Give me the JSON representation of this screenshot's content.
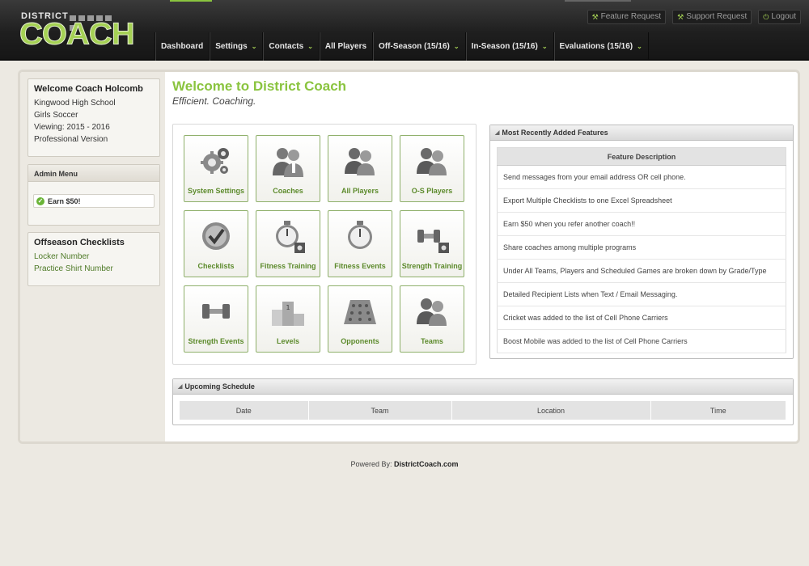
{
  "brand": {
    "top": "DISTRICT",
    "main": "COACH"
  },
  "toplinks": [
    {
      "icon": "wrench-icon",
      "label": "Feature Request"
    },
    {
      "icon": "wrench-icon",
      "label": "Support Request"
    },
    {
      "icon": "power-icon",
      "label": "Logout"
    }
  ],
  "nav": [
    {
      "label": "Dashboard",
      "dropdown": false
    },
    {
      "label": "Settings",
      "dropdown": true
    },
    {
      "label": "Contacts",
      "dropdown": true
    },
    {
      "label": "All Players",
      "dropdown": false
    },
    {
      "label": "Off-Season (15/16)",
      "dropdown": true
    },
    {
      "label": "In-Season (15/16)",
      "dropdown": true
    },
    {
      "label": "Evaluations (15/16)",
      "dropdown": true
    }
  ],
  "sidebar": {
    "welcome": "Welcome Coach Holcomb",
    "school": "Kingwood High School",
    "sport": "Girls Soccer",
    "viewing": "Viewing: 2015 - 2016",
    "version": "Professional Version",
    "admin_title": "Admin Menu",
    "earn_label": "Earn $50!",
    "checklists_title": "Offseason Checklists",
    "checklists": [
      "Locker Number",
      "Practice Shirt Number"
    ]
  },
  "main": {
    "title": "Welcome to District Coach",
    "tagline": "Efficient. Coaching."
  },
  "tiles": [
    {
      "label": "System Settings",
      "icon": "gears-icon"
    },
    {
      "label": "Coaches",
      "icon": "coaches-icon"
    },
    {
      "label": "All Players",
      "icon": "players-icon"
    },
    {
      "label": "O-S Players",
      "icon": "players-icon"
    },
    {
      "label": "Checklists",
      "icon": "checkmark-icon"
    },
    {
      "label": "Fitness Training",
      "icon": "stopwatch-gear-icon"
    },
    {
      "label": "Fitness Events",
      "icon": "stopwatch-icon"
    },
    {
      "label": "Strength Training",
      "icon": "dumbbell-gear-icon"
    },
    {
      "label": "Strength Events",
      "icon": "dumbbell-icon"
    },
    {
      "label": "Levels",
      "icon": "podium-icon"
    },
    {
      "label": "Opponents",
      "icon": "field-icon"
    },
    {
      "label": "Teams",
      "icon": "players-icon"
    }
  ],
  "features": {
    "title": "Most Recently Added Features",
    "column": "Feature Description",
    "rows": [
      "Send messages from your email address OR cell phone.",
      "Export Multiple Checklists to one Excel Spreadsheet",
      "Earn $50 when you refer another coach!!",
      "Share coaches among multiple programs",
      "Under All Teams, Players and Scheduled Games are broken down by Grade/Type",
      "Detailed Recipient Lists when Text / Email Messaging.",
      "Cricket was added to the list of Cell Phone Carriers",
      "Boost Mobile was added to the list of Cell Phone Carriers"
    ]
  },
  "schedule": {
    "title": "Upcoming Schedule",
    "columns": [
      "Date",
      "Team",
      "Location",
      "Time"
    ]
  },
  "footer": {
    "prefix": "Powered By:",
    "site": "DistrictCoach.com"
  },
  "colors": {
    "accent": "#8ac43f",
    "tile_border": "#8fb06b",
    "tile_label": "#5c8a2b",
    "header": "#1f1f1f"
  }
}
